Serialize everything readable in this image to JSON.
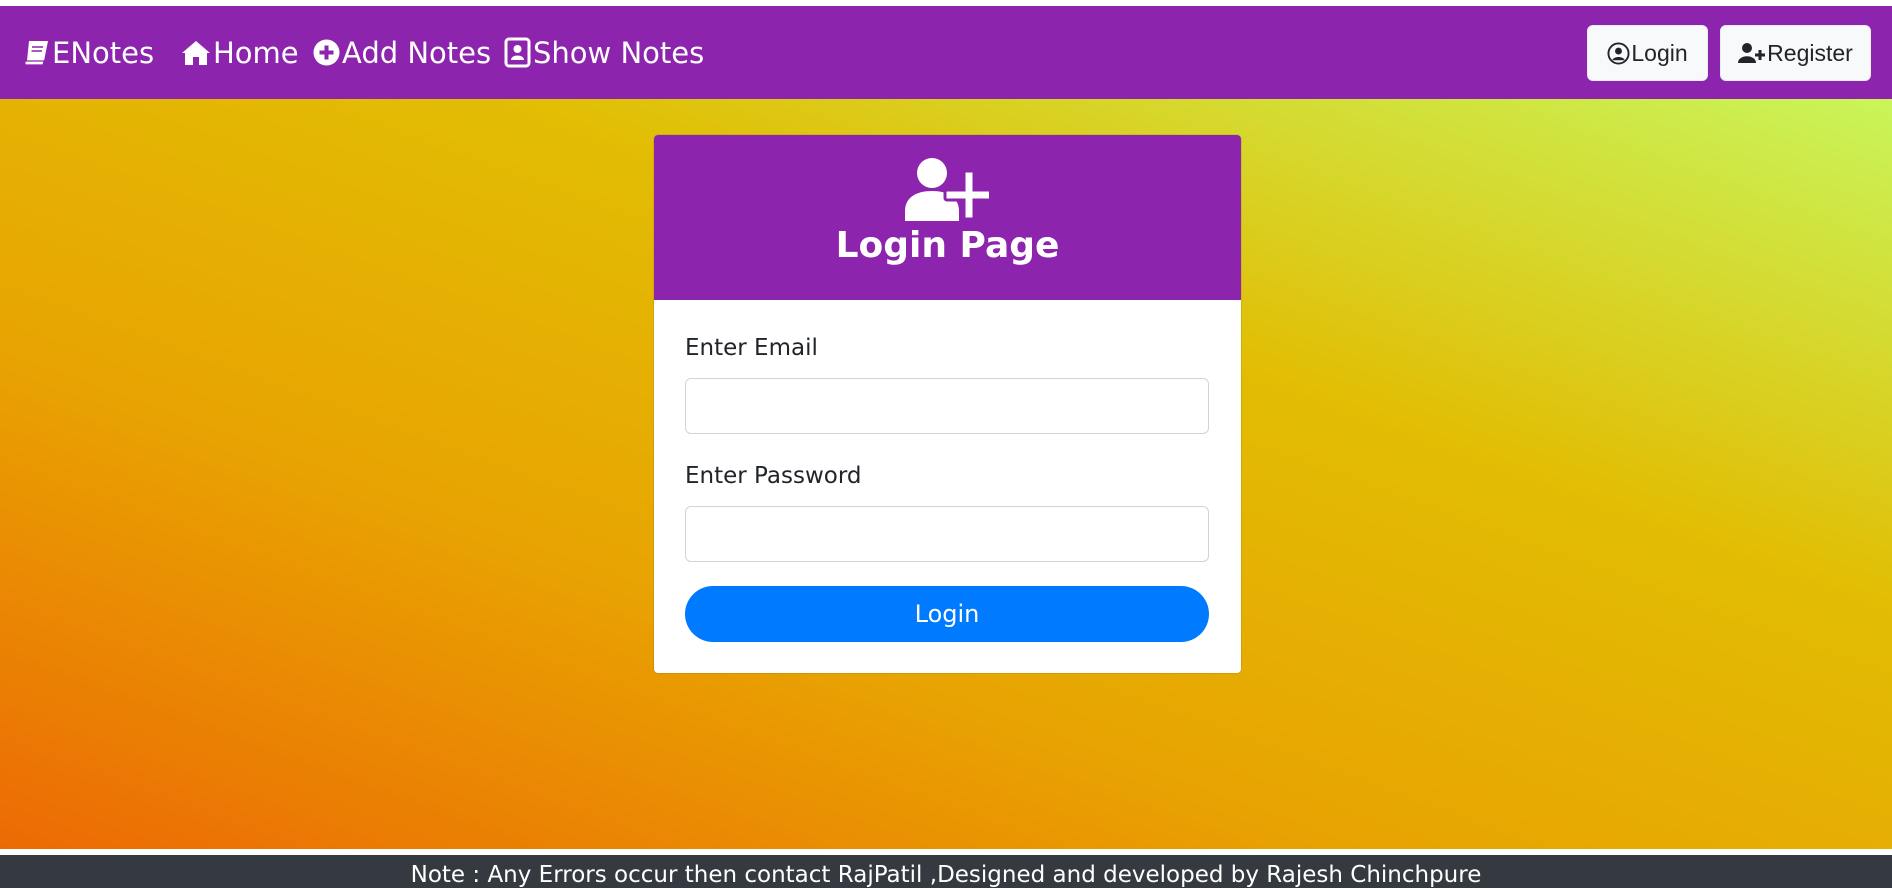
{
  "nav": {
    "brand": "ENotes",
    "home": "Home",
    "add_notes": "Add Notes",
    "show_notes": "Show Notes",
    "login": "Login",
    "register": "Register"
  },
  "login_card": {
    "title": "Login Page",
    "email_label": "Enter Email",
    "email_value": "",
    "password_label": "Enter Password",
    "password_value": "",
    "submit": "Login"
  },
  "footer": {
    "text": "Note : Any Errors occur then contact RajPatil ,Designed and developed by Rajesh Chinchpure"
  },
  "colors": {
    "navbar": "#8c24ad",
    "button_primary": "#007bff",
    "footer": "#343a40",
    "gradient_start": "#ec6a04",
    "gradient_end": "#c9f55a"
  },
  "icons": {
    "brand": "book-icon",
    "home": "home-icon",
    "add_notes": "plus-circle-icon",
    "show_notes": "address-book-icon",
    "login": "user-circle-icon",
    "register": "user-plus-icon",
    "card": "user-plus-icon"
  }
}
